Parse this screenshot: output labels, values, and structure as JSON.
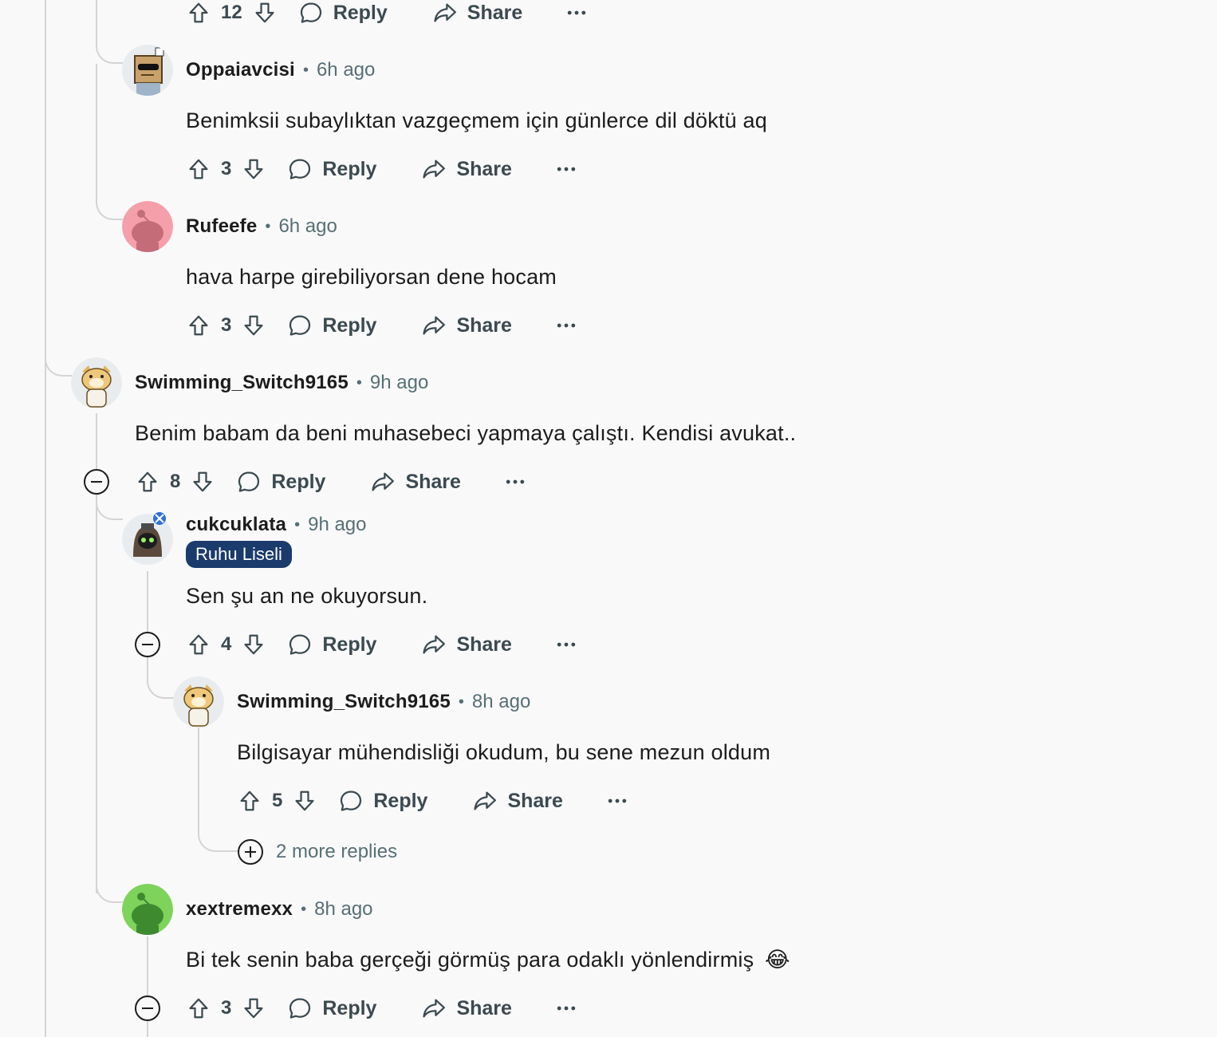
{
  "comments": {
    "c0": {
      "votes": "12",
      "reply": "Reply",
      "share": "Share"
    },
    "c1": {
      "author": "Oppaiavcisi",
      "time": "6h ago",
      "text": "Benimksii subaylıktan vazgeçmem için günlerce dil döktü aq",
      "votes": "3",
      "reply": "Reply",
      "share": "Share",
      "avatar": "cardboard-box-sunglasses-avatar"
    },
    "c2": {
      "author": "Rufeefe",
      "time": "6h ago",
      "text": "hava harpe girebiliyorsan dene hocam",
      "votes": "3",
      "reply": "Reply",
      "share": "Share",
      "avatar": "default-snoo-pink-avatar"
    },
    "c3": {
      "author": "Swimming_Switch9165",
      "time": "9h ago",
      "text": "Benim babam da beni muhasebeci yapmaya çalıştı. Kendisi avukat..",
      "votes": "8",
      "reply": "Reply",
      "share": "Share",
      "avatar": "doge-snoo-avatar"
    },
    "c4": {
      "author": "cukcuklata",
      "time": "9h ago",
      "flair": "Ruhu Liseli",
      "text": "Sen şu an ne okuyorsun.",
      "votes": "4",
      "reply": "Reply",
      "share": "Share",
      "avatar": "hooded-green-eyes-avatar"
    },
    "c5": {
      "author": "Swimming_Switch9165",
      "time": "8h ago",
      "text": "Bilgisayar mühendisliği okudum, bu sene mezun oldum",
      "votes": "5",
      "reply": "Reply",
      "share": "Share",
      "avatar": "doge-snoo-avatar"
    },
    "c6": {
      "author": "xextremexx",
      "time": "8h ago",
      "text": "Bi tek senin baba gerçeği görmüş para odaklı yönlendirmiş",
      "emoji": "😂",
      "votes": "3",
      "reply": "Reply",
      "share": "Share",
      "avatar": "default-snoo-green-avatar"
    }
  },
  "more_replies": "2 more replies",
  "separator": "•",
  "colors": {
    "flair_bg": "#1a3b6c",
    "text": "#1c1c1c",
    "muted": "#576f76",
    "thread_line": "#d4d4d4",
    "pink_avatar": "#f59fab",
    "green_avatar": "#7ed35b"
  }
}
